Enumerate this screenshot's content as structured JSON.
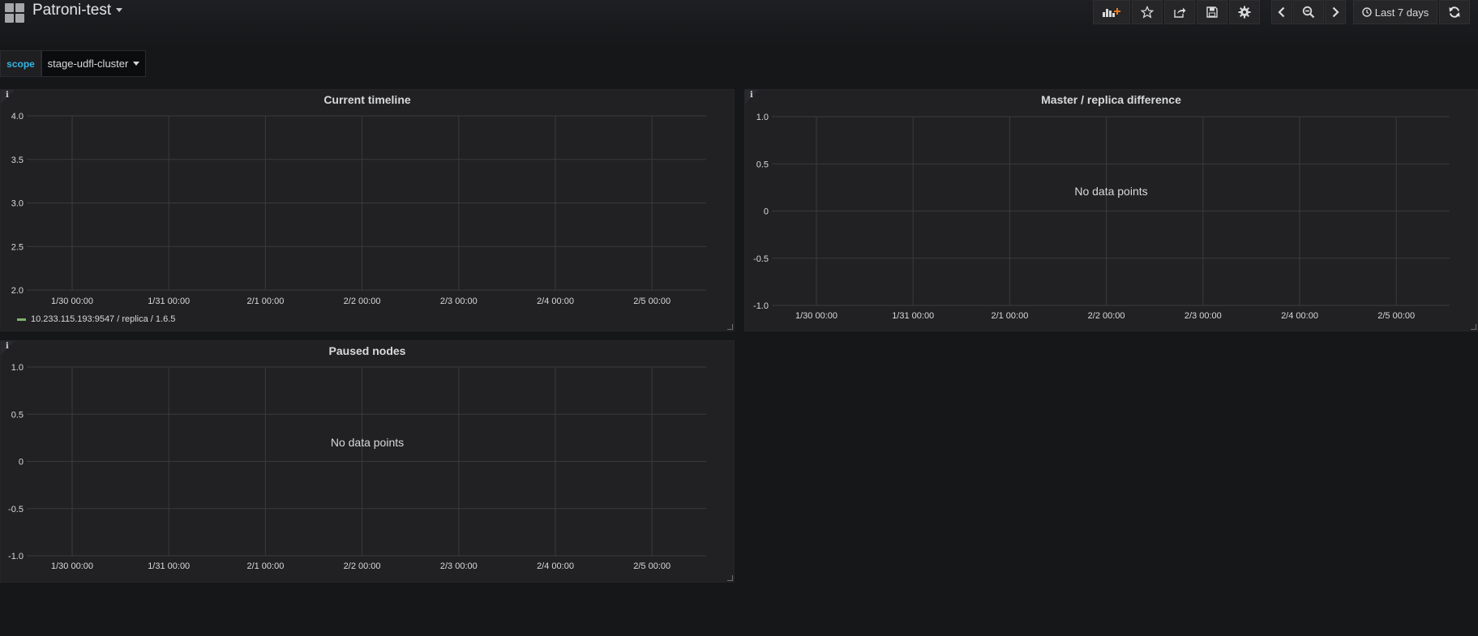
{
  "navbar": {
    "title": "Patroni-test",
    "time_range": "Last 7 days"
  },
  "variables": {
    "label": "scope",
    "value": "stage-udfl-cluster"
  },
  "x_ticks": [
    "1/30 00:00",
    "1/31 00:00",
    "2/1 00:00",
    "2/2 00:00",
    "2/3 00:00",
    "2/4 00:00",
    "2/5 00:00"
  ],
  "panels": [
    {
      "title": "Current timeline",
      "y_ticks": [
        "4.0",
        "3.5",
        "3.0",
        "2.5",
        "2.0"
      ],
      "legend": "10.233.115.193:9547 / replica / 1.6.5",
      "legend_color": "#7eb26d"
    },
    {
      "title": "Master / replica difference",
      "y_ticks": [
        "1.0",
        "0.5",
        "0",
        "-0.5",
        "-1.0"
      ],
      "no_data": "No data points"
    },
    {
      "title": "Paused nodes",
      "y_ticks": [
        "1.0",
        "0.5",
        "0",
        "-0.5",
        "-1.0"
      ],
      "no_data": "No data points"
    }
  ],
  "chart_data": [
    {
      "type": "line",
      "title": "Current timeline",
      "x": [
        "1/30 00:00",
        "1/31 00:00",
        "2/1 00:00",
        "2/2 00:00",
        "2/3 00:00",
        "2/4 00:00",
        "2/5 00:00"
      ],
      "ylim": [
        2.0,
        4.0
      ],
      "y_ticks": [
        4.0,
        3.5,
        3.0,
        2.5,
        2.0
      ],
      "series": [
        {
          "name": "10.233.115.193:9547 / replica / 1.6.5",
          "values": []
        }
      ],
      "grid": true,
      "legend": "bottom-left"
    },
    {
      "type": "line",
      "title": "Master / replica difference",
      "x": [
        "1/30 00:00",
        "1/31 00:00",
        "2/1 00:00",
        "2/2 00:00",
        "2/3 00:00",
        "2/4 00:00",
        "2/5 00:00"
      ],
      "ylim": [
        -1.0,
        1.0
      ],
      "y_ticks": [
        1.0,
        0.5,
        0,
        -0.5,
        -1.0
      ],
      "series": [],
      "grid": true,
      "annotation": "No data points"
    },
    {
      "type": "line",
      "title": "Paused nodes",
      "x": [
        "1/30 00:00",
        "1/31 00:00",
        "2/1 00:00",
        "2/2 00:00",
        "2/3 00:00",
        "2/4 00:00",
        "2/5 00:00"
      ],
      "ylim": [
        -1.0,
        1.0
      ],
      "y_ticks": [
        1.0,
        0.5,
        0,
        -0.5,
        -1.0
      ],
      "series": [],
      "grid": true,
      "annotation": "No data points"
    }
  ]
}
